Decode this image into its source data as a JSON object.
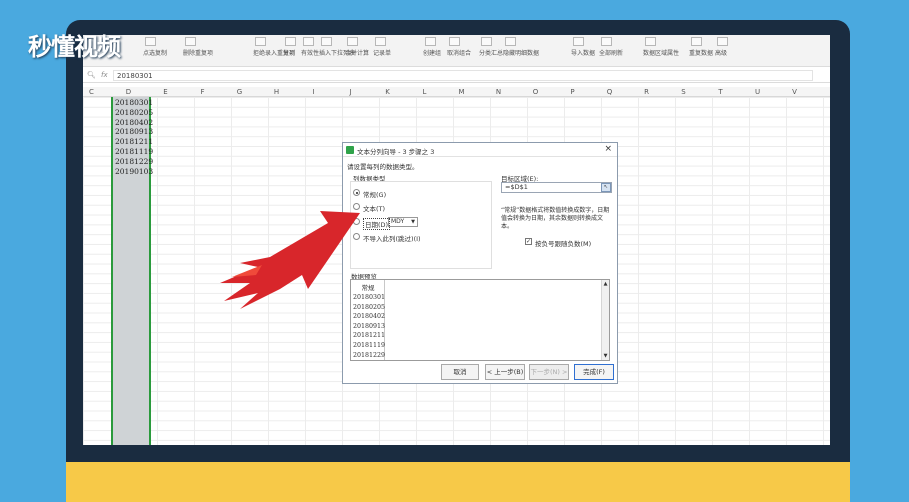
{
  "watermark": {
    "logo_text": "秒懂视频"
  },
  "ribbon": {
    "items": [
      "点选复制",
      "删除重复项",
      "拒绝录入重复项",
      "分列",
      "有效性",
      "插入下拉列表",
      "合并计算",
      "记录单",
      "创建组",
      "取消组合",
      "分类汇总",
      "隐藏明细数据",
      "导入数据",
      "全部刷新",
      "数据区域属性",
      "重复数据",
      "高级"
    ]
  },
  "formula_bar": {
    "zoom_icon": "magnifier-icon",
    "fx": "fx",
    "value": "20180301"
  },
  "columns": [
    "C",
    "D",
    "E",
    "F",
    "G",
    "H",
    "I",
    "J",
    "K",
    "L",
    "M",
    "N",
    "O",
    "P",
    "Q",
    "R",
    "S",
    "T",
    "U",
    "V"
  ],
  "cells": [
    "20180301",
    "20180205",
    "20180402",
    "20180913",
    "20181211",
    "20181119",
    "20181229",
    "20190103"
  ],
  "dialog": {
    "title": "文本分列向导 - 3 步骤之 3",
    "instruction": "请设置每列的数据类型。",
    "group_label": "列数据类型",
    "options": [
      "常规(G)",
      "文本(T)",
      "日期(D)",
      "不导入此列(跳过)(I)"
    ],
    "selected_option": 0,
    "date_format": "MDY",
    "target_label": "目标区域(E):",
    "target_value": "=$D$1",
    "description": "“常规”数据格式将数值转换成数字，日期值会转换为日期，其余数据则转换成文本。",
    "checkbox_label": "按负号跟随负数(M)",
    "checkbox_checked": true,
    "preview_label": "数据预览",
    "preview_header": "常规",
    "preview_values": [
      "20180301",
      "20180205",
      "20180402",
      "20180913",
      "20181211",
      "20181119",
      "20181229"
    ],
    "buttons": {
      "cancel": "取消",
      "back": "< 上一步(B)",
      "next": "下一步(N) >",
      "finish": "完成(F)"
    }
  }
}
